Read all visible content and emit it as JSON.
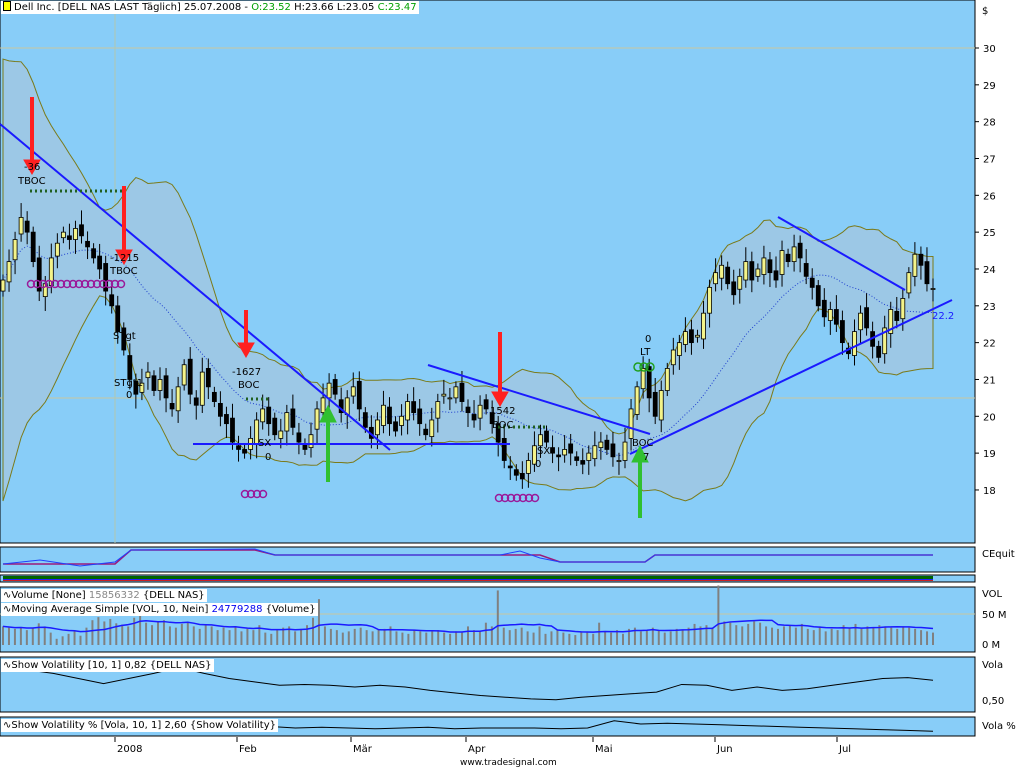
{
  "header": {
    "symbol_text": "Dell Inc. [DELL NAS LAST Täglich] 25.07.2008 -",
    "open": "O:23.52",
    "high": "H:23.66",
    "low": "L:23.05",
    "close": "C:23.47"
  },
  "axis": {
    "currency": "$",
    "price_ticks": [
      "30",
      "29",
      "28",
      "27",
      "26",
      "25",
      "24",
      "23",
      "22",
      "21",
      "20",
      "19",
      "18"
    ],
    "trend_value": "22.2",
    "months": [
      "2008",
      "Feb",
      "Mär",
      "Apr",
      "Mai",
      "Jun",
      "Jul"
    ]
  },
  "annotations": {
    "tboc": "TBOC",
    "stgt": "STgt",
    "stgt1": "STgt1",
    "zero": "0",
    "boc": "BOC",
    "n1542": "1542",
    "lt": "LT",
    "sx": "SX",
    "n1627": "-1627",
    "n1215": "-1215",
    "n36": "-36",
    "n7": "7"
  },
  "panels": {
    "cequity": "CEquit",
    "vol_axis": "VOL",
    "vol_50": "50 M",
    "vol_0": "0 M",
    "vola": "Vola",
    "vola_050": "0,50",
    "vola_pct": "Vola %",
    "vol_legend": {
      "name": "Volume [None]",
      "value": "15856332",
      "src": "{DELL NAS}"
    },
    "ma_legend": {
      "name": "Moving Average Simple [VOL, 10, Nein]",
      "value": "24779288",
      "src": "{Volume}"
    },
    "vola_legend": "Show Volatility [10, 1] 0,82 {DELL NAS}",
    "volapct_legend": "Show Volatility % [Vola, 10, 1] 2,60 {Show Volatility}"
  },
  "footer": "www.tradesignal.com",
  "chart_data": {
    "type": "candlestick",
    "title": "Dell Inc. [DELL NAS LAST Täglich]",
    "ylim": [
      17,
      31
    ],
    "closes": [
      23.7,
      24.2,
      24.8,
      25.4,
      25.0,
      24.2,
      23.4,
      23.6,
      24.3,
      24.7,
      25.0,
      24.8,
      25.1,
      24.9,
      24.6,
      24.3,
      24.0,
      23.4,
      23.0,
      22.3,
      21.8,
      21.0,
      20.6,
      20.9,
      21.2,
      20.7,
      21.0,
      20.5,
      20.2,
      20.8,
      21.4,
      20.6,
      20.3,
      21.2,
      20.8,
      20.4,
      20.0,
      19.8,
      19.3,
      19.1,
      19.0,
      19.4,
      19.9,
      20.2,
      19.8,
      19.5,
      19.6,
      20.1,
      19.7,
      19.3,
      19.1,
      19.5,
      20.2,
      20.5,
      20.9,
      20.6,
      20.1,
      20.5,
      20.8,
      20.2,
      19.7,
      19.4,
      19.9,
      20.3,
      19.8,
      19.6,
      20.0,
      20.4,
      20.1,
      19.8,
      19.5,
      19.9,
      20.4,
      20.6,
      20.5,
      20.8,
      20.4,
      20.1,
      19.9,
      20.3,
      20.2,
      19.8,
      19.3,
      18.8,
      18.6,
      18.4,
      18.3,
      18.8,
      19.2,
      19.5,
      19.3,
      19.0,
      18.9,
      19.1,
      19.0,
      18.8,
      18.7,
      19.0,
      19.2,
      19.3,
      19.1,
      18.9,
      18.8,
      19.3,
      20.2,
      20.8,
      21.3,
      20.5,
      20.0,
      20.7,
      21.3,
      21.8,
      22.0,
      22.3,
      22.0,
      22.2,
      22.8,
      23.5,
      23.9,
      24.1,
      23.6,
      23.3,
      23.8,
      24.2,
      23.7,
      24.0,
      24.3,
      23.9,
      23.7,
      24.5,
      24.2,
      24.6,
      24.3,
      23.8,
      23.5,
      23.0,
      22.7,
      22.9,
      22.5,
      22.0,
      21.7,
      22.3,
      22.8,
      22.4,
      21.9,
      21.6,
      22.4,
      22.9,
      22.6,
      23.2,
      23.9,
      24.4,
      24.1,
      23.6,
      23.47
    ],
    "volumes_m": [
      30,
      28,
      26,
      29,
      24,
      27,
      35,
      30,
      20,
      10,
      14,
      18,
      22,
      15,
      28,
      40,
      45,
      38,
      42,
      35,
      33,
      30,
      44,
      48,
      36,
      32,
      38,
      40,
      30,
      28,
      34,
      36,
      30,
      26,
      33,
      30,
      24,
      28,
      24,
      30,
      22,
      26,
      24,
      32,
      20,
      18,
      24,
      28,
      30,
      22,
      26,
      32,
      44,
      74,
      30,
      26,
      24,
      20,
      22,
      26,
      28,
      24,
      22,
      25,
      26,
      30,
      22,
      20,
      18,
      24,
      22,
      20,
      22,
      24,
      20,
      18,
      22,
      20,
      30,
      24,
      22,
      36,
      30,
      88,
      28,
      24,
      26,
      28,
      22,
      20,
      30,
      18,
      22,
      24,
      20,
      18,
      16,
      22,
      20,
      18,
      36,
      22,
      20,
      24,
      18,
      26,
      28,
      22,
      24,
      28,
      24,
      20,
      22,
      26,
      24,
      28,
      34,
      30,
      32,
      28,
      96,
      38,
      36,
      32,
      30,
      34,
      38,
      36,
      30,
      28,
      26,
      30,
      32,
      28,
      34,
      26,
      24,
      30,
      22,
      26,
      24,
      32,
      28,
      34,
      26,
      30,
      28,
      32,
      30,
      28,
      26,
      30,
      28,
      26,
      24,
      22,
      20
    ],
    "vola": [
      0.95,
      0.9,
      0.86,
      0.8,
      0.74,
      0.8,
      0.86,
      0.93,
      0.86,
      0.8,
      0.76,
      0.72,
      0.73,
      0.72,
      0.7,
      0.72,
      0.7,
      0.66,
      0.63,
      0.6,
      0.58,
      0.56,
      0.55,
      0.58,
      0.6,
      0.62,
      0.64,
      0.73,
      0.72,
      0.66,
      0.7,
      0.66,
      0.68,
      0.72,
      0.76,
      0.8,
      0.81,
      0.78
    ],
    "vola_pct": [
      3.8,
      3.6,
      3.4,
      3.0,
      3.5,
      3.2,
      3.0,
      3.2,
      3.1,
      3.0,
      3.2,
      3.0,
      3.1,
      3.0,
      2.9,
      3.0,
      3.1,
      2.9,
      3.0,
      3.0,
      3.0,
      2.9,
      3.0,
      3.9,
      3.5,
      3.6,
      3.5,
      3.4,
      3.3,
      3.2,
      3.1,
      3.0,
      2.9,
      2.8,
      2.7,
      2.6
    ]
  }
}
